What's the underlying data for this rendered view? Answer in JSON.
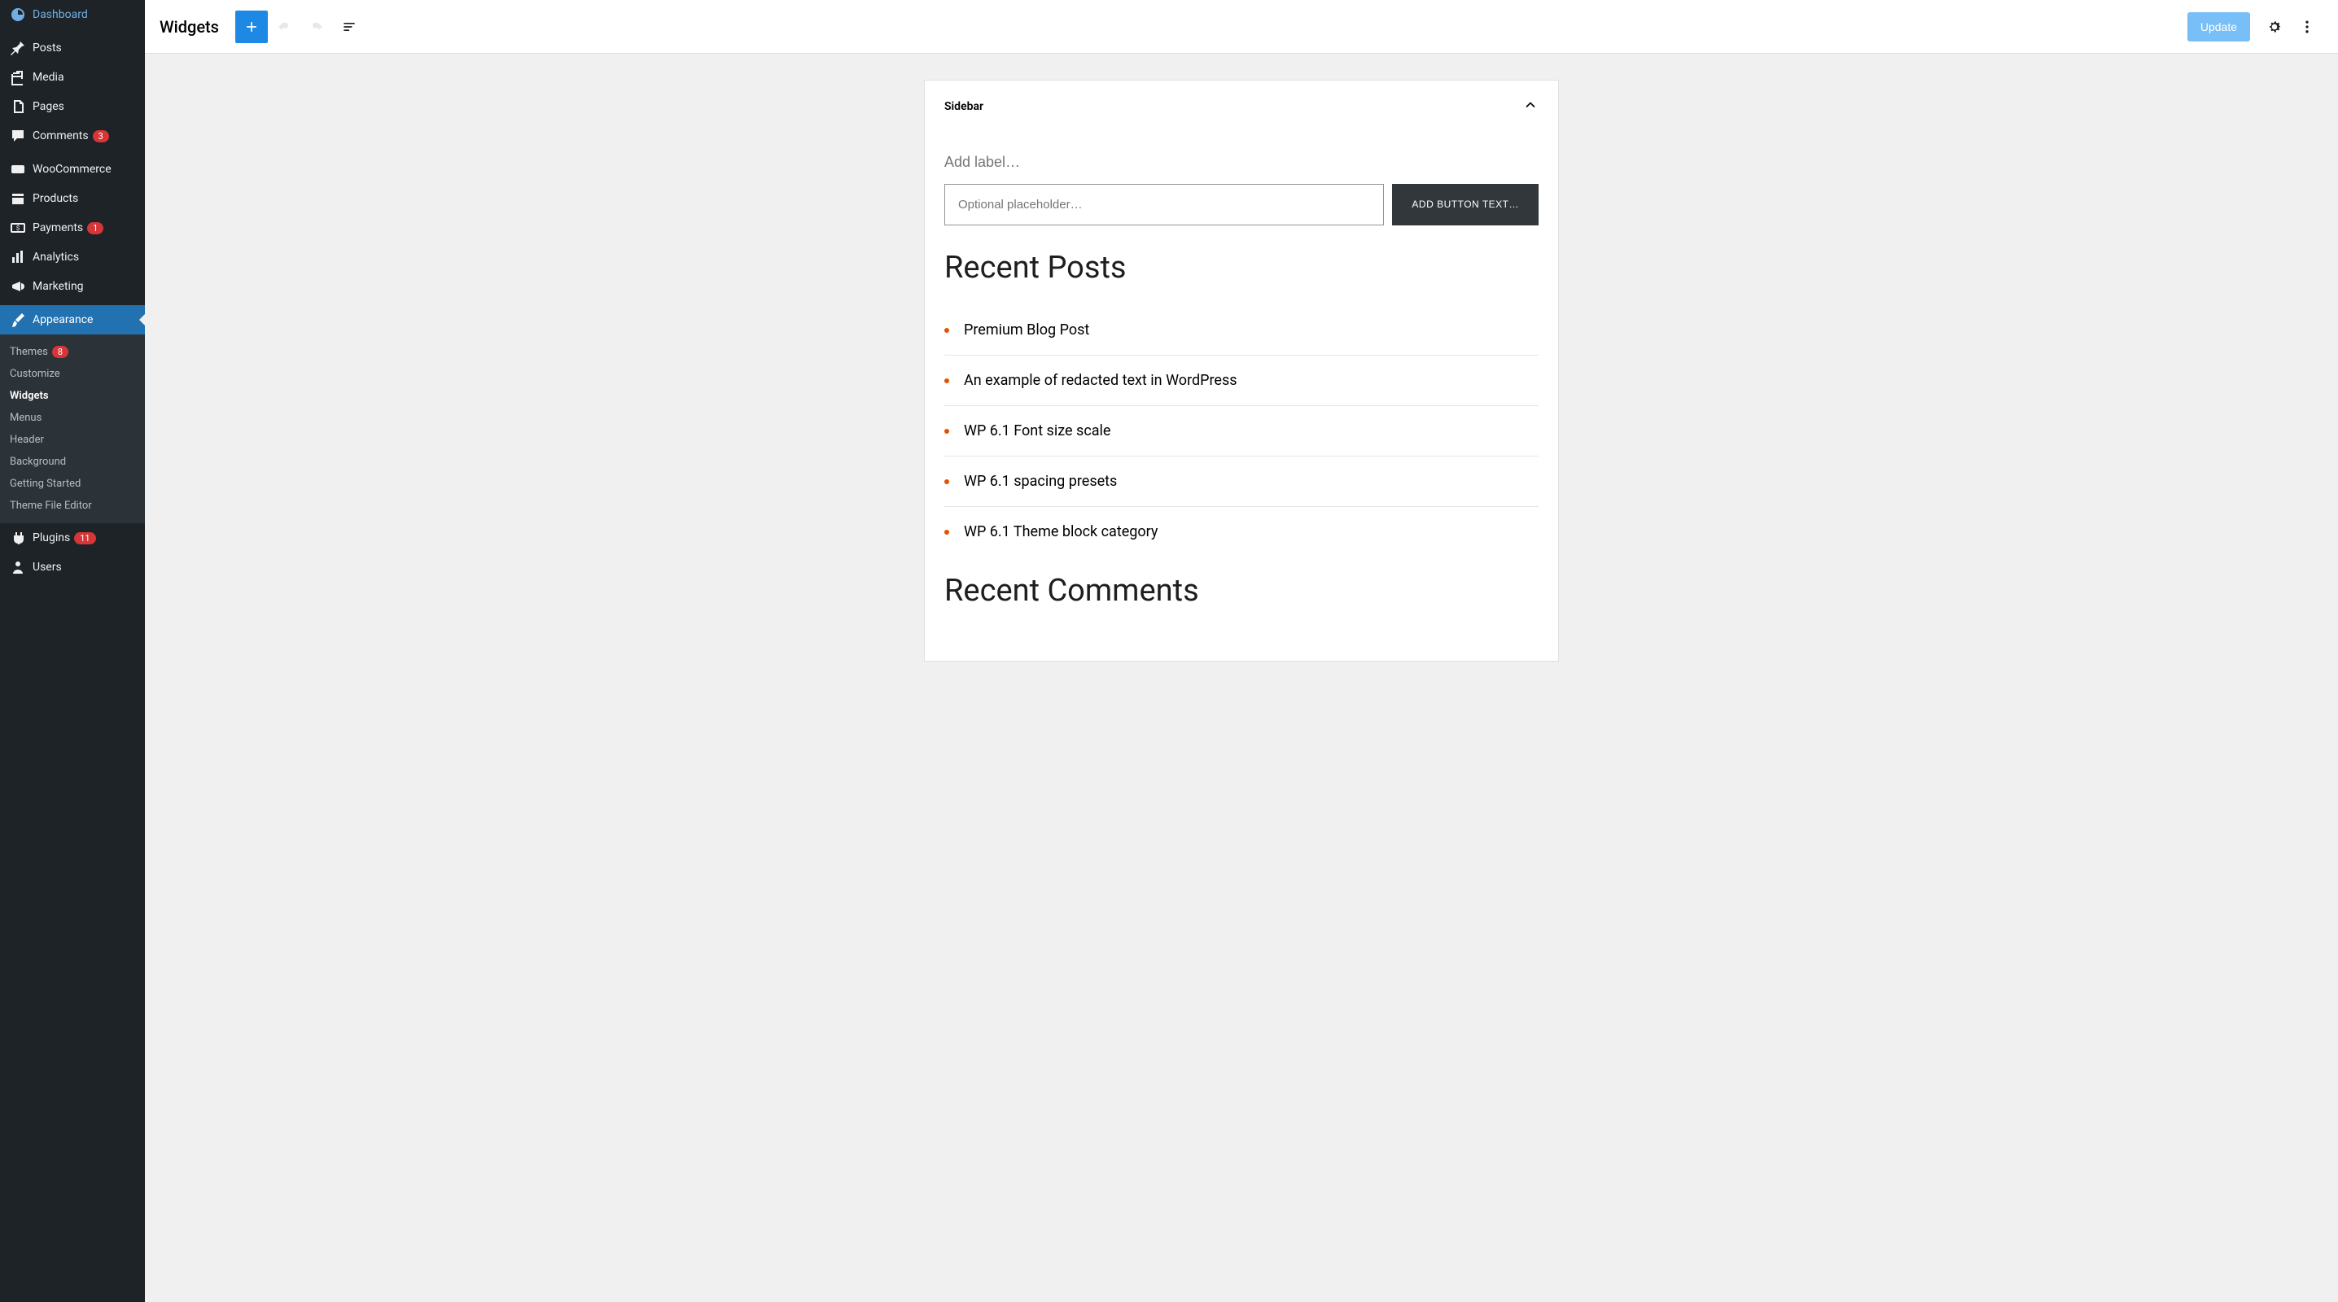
{
  "sidebar": {
    "items": [
      {
        "label": "Dashboard",
        "icon": "dashboard"
      },
      {
        "label": "Posts",
        "icon": "pin"
      },
      {
        "label": "Media",
        "icon": "media"
      },
      {
        "label": "Pages",
        "icon": "pages"
      },
      {
        "label": "Comments",
        "icon": "comment",
        "badge": "3"
      },
      {
        "label": "WooCommerce",
        "icon": "woo"
      },
      {
        "label": "Products",
        "icon": "products"
      },
      {
        "label": "Payments",
        "icon": "payments",
        "badge": "1"
      },
      {
        "label": "Analytics",
        "icon": "analytics"
      },
      {
        "label": "Marketing",
        "icon": "megaphone"
      },
      {
        "label": "Appearance",
        "icon": "brush",
        "active": true
      },
      {
        "label": "Plugins",
        "icon": "plug",
        "badge": "11"
      },
      {
        "label": "Users",
        "icon": "user"
      }
    ],
    "submenu": [
      {
        "label": "Themes",
        "badge": "8"
      },
      {
        "label": "Customize"
      },
      {
        "label": "Widgets",
        "current": true
      },
      {
        "label": "Menus"
      },
      {
        "label": "Header"
      },
      {
        "label": "Background"
      },
      {
        "label": "Getting Started"
      },
      {
        "label": "Theme File Editor"
      }
    ]
  },
  "toolbar": {
    "title": "Widgets",
    "update_label": "Update"
  },
  "editor": {
    "panel_title": "Sidebar",
    "label_placeholder": "Add label…",
    "input_placeholder": "Optional placeholder…",
    "button_placeholder": "ADD BUTTON TEXT…",
    "recent_posts_heading": "Recent Posts",
    "recent_comments_heading": "Recent Comments",
    "posts": [
      "Premium Blog Post",
      "An example of redacted text in WordPress",
      "WP 6.1 Font size scale",
      "WP 6.1 spacing presets",
      "WP 6.1 Theme block category"
    ]
  }
}
